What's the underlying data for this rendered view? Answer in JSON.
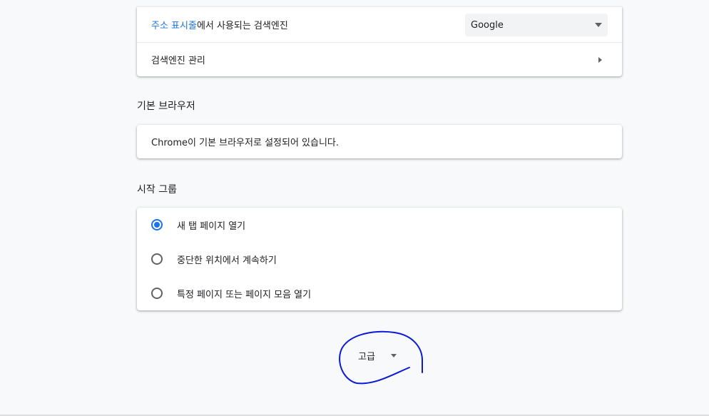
{
  "search": {
    "address_bar_link": "주소 표시줄",
    "address_bar_suffix": "에서 사용되는 검색엔진",
    "engine_selected": "Google",
    "manage_label": "검색엔진 관리"
  },
  "default_browser": {
    "section_title": "기본 브라우저",
    "status_text": "Chrome이 기본 브라우저로 설정되어 있습니다."
  },
  "startup": {
    "section_title": "시작 그룹",
    "options": [
      {
        "label": "새 탭 페이지 열기",
        "checked": true
      },
      {
        "label": "중단한 위치에서 계속하기",
        "checked": false
      },
      {
        "label": "특정 페이지 또는 페이지 모음 열기",
        "checked": false
      }
    ]
  },
  "advanced": {
    "label": "고급"
  },
  "colors": {
    "accent": "#1a73e8",
    "annotation": "#0a1ad6"
  },
  "icons": {
    "select_caret": "chevron-down-icon",
    "manage_arrow": "chevron-right-icon",
    "advanced_caret": "chevron-down-icon"
  }
}
